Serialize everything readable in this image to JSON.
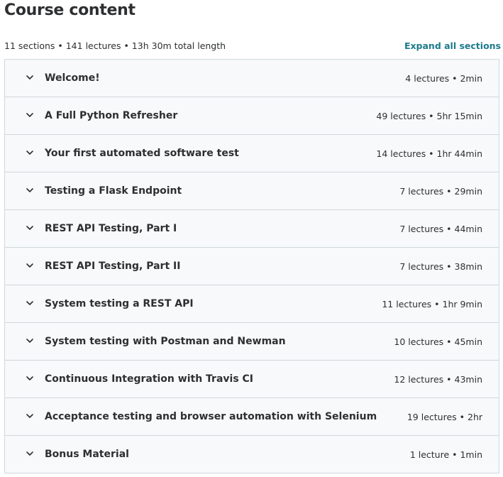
{
  "header": {
    "title": "Course content",
    "summary": "11 sections • 141 lectures • 13h 30m total length",
    "expand_all_label": "Expand all sections"
  },
  "colors": {
    "accent": "#1d7a8c",
    "text": "#2d2f31",
    "border": "#d1d7dc",
    "section_bg": "#f7f9fa"
  },
  "sections": [
    {
      "title": "Welcome!",
      "meta": "4 lectures • 2min",
      "icon": "chevron-down-icon"
    },
    {
      "title": "A Full Python Refresher",
      "meta": "49 lectures • 5hr 15min",
      "icon": "chevron-down-icon"
    },
    {
      "title": "Your first automated software test",
      "meta": "14 lectures • 1hr 44min",
      "icon": "chevron-down-icon"
    },
    {
      "title": "Testing a Flask Endpoint",
      "meta": "7 lectures • 29min",
      "icon": "chevron-down-icon"
    },
    {
      "title": "REST API Testing, Part I",
      "meta": "7 lectures • 44min",
      "icon": "chevron-down-icon"
    },
    {
      "title": "REST API Testing, Part II",
      "meta": "7 lectures • 38min",
      "icon": "chevron-down-icon"
    },
    {
      "title": "System testing a REST API",
      "meta": "11 lectures • 1hr 9min",
      "icon": "chevron-down-icon"
    },
    {
      "title": "System testing with Postman and Newman",
      "meta": "10 lectures • 45min",
      "icon": "chevron-down-icon"
    },
    {
      "title": "Continuous Integration with Travis CI",
      "meta": "12 lectures • 43min",
      "icon": "chevron-down-icon"
    },
    {
      "title": "Acceptance testing and browser automation with Selenium",
      "meta": "19 lectures • 2hr",
      "icon": "chevron-down-icon"
    },
    {
      "title": "Bonus Material",
      "meta": "1 lecture • 1min",
      "icon": "chevron-down-icon"
    }
  ]
}
